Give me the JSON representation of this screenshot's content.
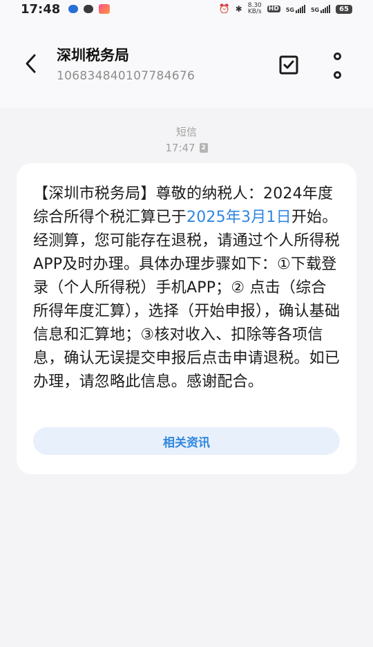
{
  "status_bar": {
    "time": "17:48",
    "speed_value": "8.30",
    "speed_unit": "KB/s",
    "hd_label": "HD",
    "net1": "5G",
    "net2": "5G",
    "battery": "65"
  },
  "header": {
    "title": "深圳税务局",
    "subtitle": "106834840107784676"
  },
  "message_meta": {
    "type": "短信",
    "time": "17:47",
    "sim": "2"
  },
  "message": {
    "text_before_link": "【深圳市税务局】尊敬的纳税人：2024年度综合所得个税汇算已于",
    "link_text": "2025年3月1日",
    "text_after_link": "开始。经测算，您可能存在退税，请通过个人所得税APP及时办理。具体办理步骤如下：①下载登录（个人所得税）手机APP；② 点击（综合所得年度汇算），选择（开始申报），确认基础信息和汇算地；③核对收入、扣除等各项信息，确认无误提交申报后点击申请退税。如已办理，请忽略此信息。感谢配合。",
    "related_button": "相关资讯"
  },
  "colors": {
    "accent": "#2f86e0",
    "background": "#f4f4f6",
    "card": "#ffffff"
  }
}
